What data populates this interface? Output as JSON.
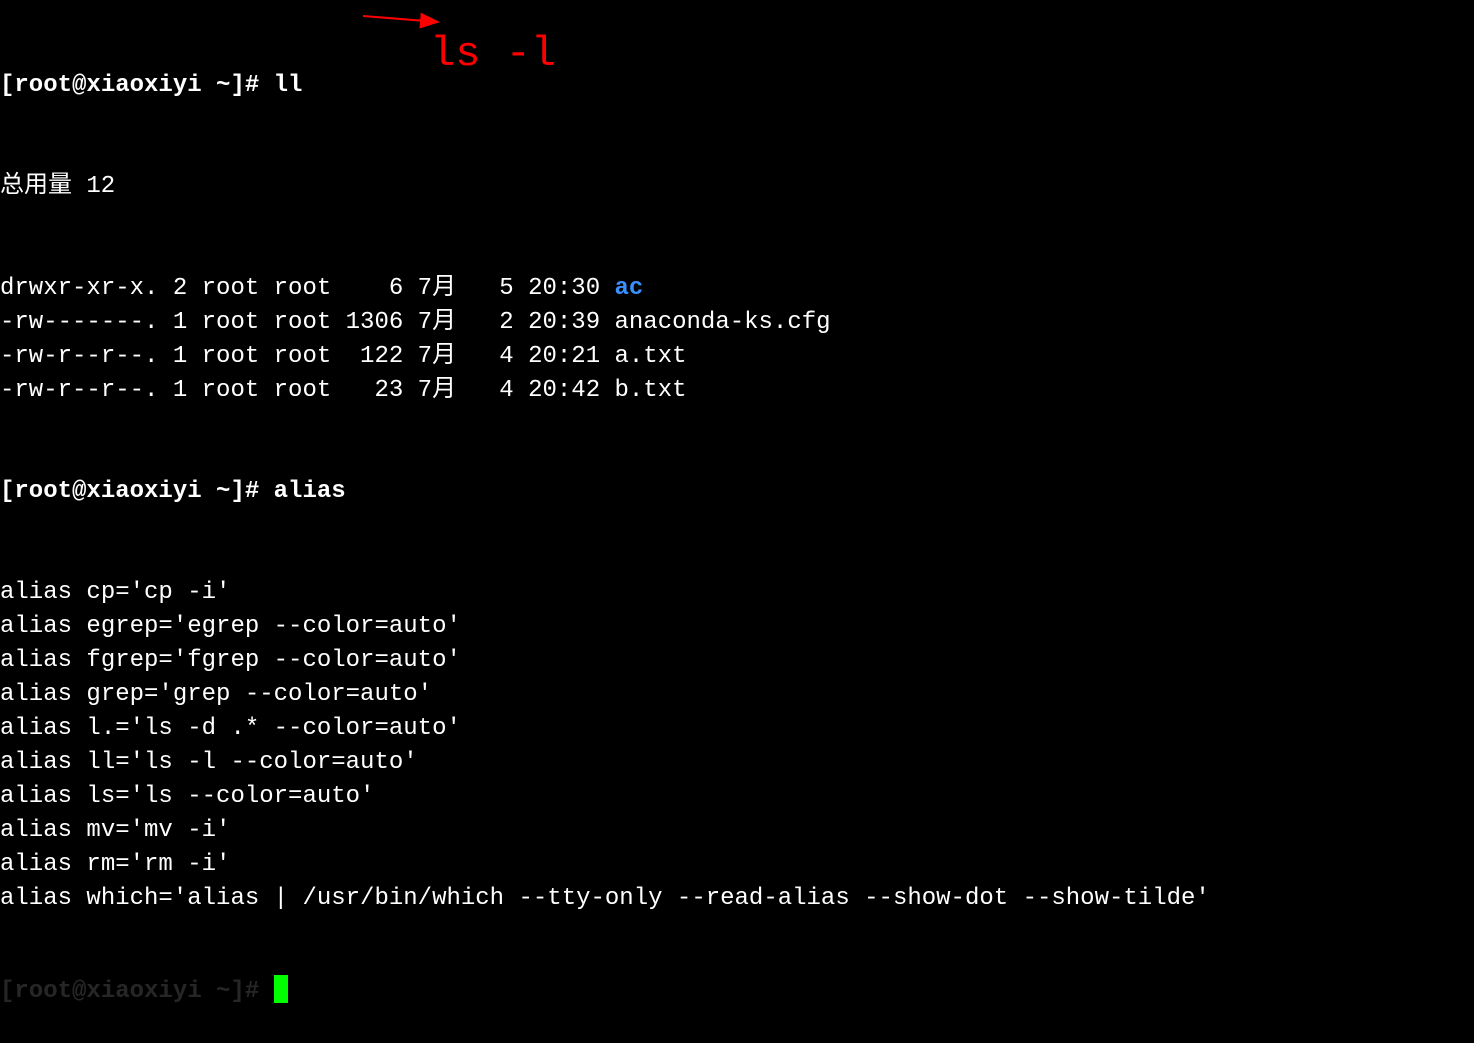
{
  "prompt1": "[root@xiaoxiyi ~]# ",
  "cmd1": "ll",
  "total_line": "总用量 12",
  "listing": [
    {
      "perms": "drwxr-xr-x.",
      "links": "2",
      "owner": "root",
      "group": "root",
      "size": "   6",
      "month": "7月",
      "day": "  5",
      "time": "20:30",
      "name": "ac",
      "is_dir": true
    },
    {
      "perms": "-rw-------.",
      "links": "1",
      "owner": "root",
      "group": "root",
      "size": "1306",
      "month": "7月",
      "day": "  2",
      "time": "20:39",
      "name": "anaconda-ks.cfg",
      "is_dir": false
    },
    {
      "perms": "-rw-r--r--.",
      "links": "1",
      "owner": "root",
      "group": "root",
      "size": " 122",
      "month": "7月",
      "day": "  4",
      "time": "20:21",
      "name": "a.txt",
      "is_dir": false
    },
    {
      "perms": "-rw-r--r--.",
      "links": "1",
      "owner": "root",
      "group": "root",
      "size": "  23",
      "month": "7月",
      "day": "  4",
      "time": "20:42",
      "name": "b.txt",
      "is_dir": false
    }
  ],
  "prompt2": "[root@xiaoxiyi ~]# ",
  "cmd2": "alias",
  "aliases": [
    "alias cp='cp -i'",
    "alias egrep='egrep --color=auto'",
    "alias fgrep='fgrep --color=auto'",
    "alias grep='grep --color=auto'",
    "alias l.='ls -d .* --color=auto'",
    "alias ll='ls -l --color=auto'",
    "alias ls='ls --color=auto'",
    "alias mv='mv -i'",
    "alias rm='rm -i'",
    "alias which='alias | /usr/bin/which --tty-only --read-alias --show-dot --show-tilde'"
  ],
  "prompt3_partial": "[root@xiaoxiyi ~]# ",
  "annotation_text": "ls -l"
}
